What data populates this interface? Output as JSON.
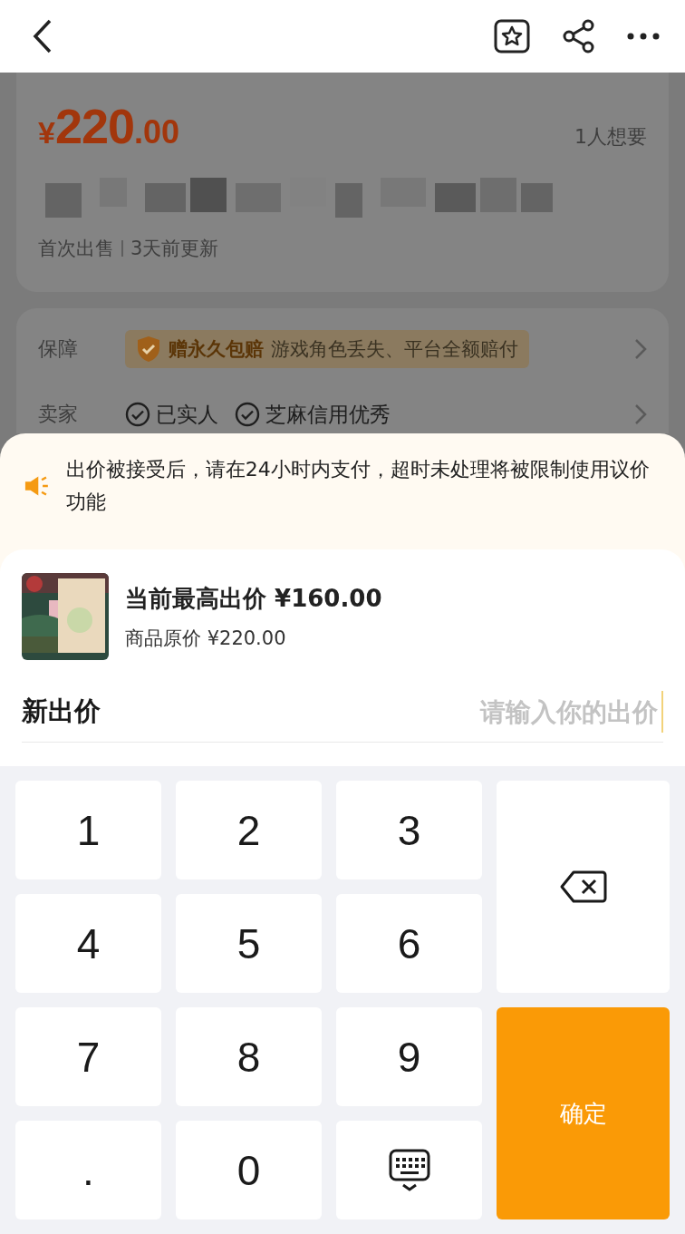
{
  "top_bar": {
    "actions": [
      {
        "kind": "favorite"
      },
      {
        "kind": "share"
      },
      {
        "kind": "more"
      }
    ]
  },
  "listing": {
    "currency": "¥",
    "price_main": "220",
    "price_decimal": ".00",
    "wanted": "1人想要",
    "tags": [
      "首次出售",
      "3天前更新"
    ]
  },
  "info_rows": [
    {
      "label": "保障",
      "badge_title": "赠永久包赔",
      "badge_text": "游戏角色丢失、平台全额赔付"
    },
    {
      "label": "卖家",
      "checks": [
        "已实人",
        "芝麻信用优秀"
      ]
    }
  ],
  "notice": {
    "text": "出价被接受后，请在24小时内支付，超时未处理将被限制使用议价功能"
  },
  "offer": {
    "kind": "picture",
    "highest": "当前最高出价 ¥160.00",
    "original": "商品原价 ¥220.00"
  },
  "new_offer": {
    "label": "新出价",
    "placeholder": "请输入你的出价"
  },
  "keypad": [
    {
      "kind": "digit",
      "label": "1"
    },
    {
      "kind": "digit",
      "label": "2"
    },
    {
      "kind": "digit",
      "label": "3"
    },
    {
      "kind": "backspace"
    },
    {
      "kind": "digit",
      "label": "4"
    },
    {
      "kind": "digit",
      "label": "5"
    },
    {
      "kind": "digit",
      "label": "6"
    },
    {
      "kind": "digit",
      "label": "7"
    },
    {
      "kind": "digit",
      "label": "8"
    },
    {
      "kind": "digit",
      "label": "9"
    },
    {
      "kind": "confirm",
      "label": "确定"
    },
    {
      "kind": "digit",
      "label": "."
    },
    {
      "kind": "digit",
      "label": "0"
    },
    {
      "kind": "hide"
    }
  ]
}
